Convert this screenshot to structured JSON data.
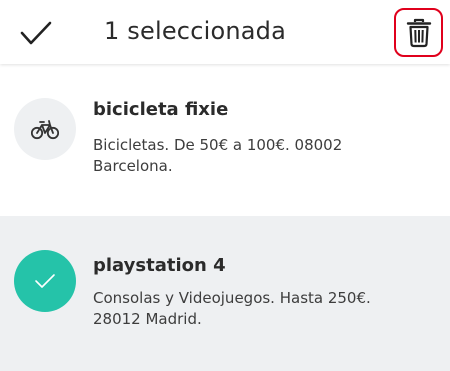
{
  "header": {
    "title": "1 seleccionada",
    "confirm_icon": "checkmark-icon",
    "delete_icon": "trash-icon",
    "delete_highlight_color": "#e0001c"
  },
  "alerts": [
    {
      "title": "bicicleta fixie",
      "description": "Bicicletas. De 50€ a 100€. 08002 Barcelona.",
      "icon": "bicycle-icon",
      "selected": false
    },
    {
      "title": "playstation 4",
      "description": "Consolas y Videojuegos. Hasta 250€. 28012 Madrid.",
      "icon": "check-icon",
      "selected": true
    }
  ],
  "colors": {
    "accent": "#25c3a9",
    "selected_row_bg": "#eef0f2"
  }
}
